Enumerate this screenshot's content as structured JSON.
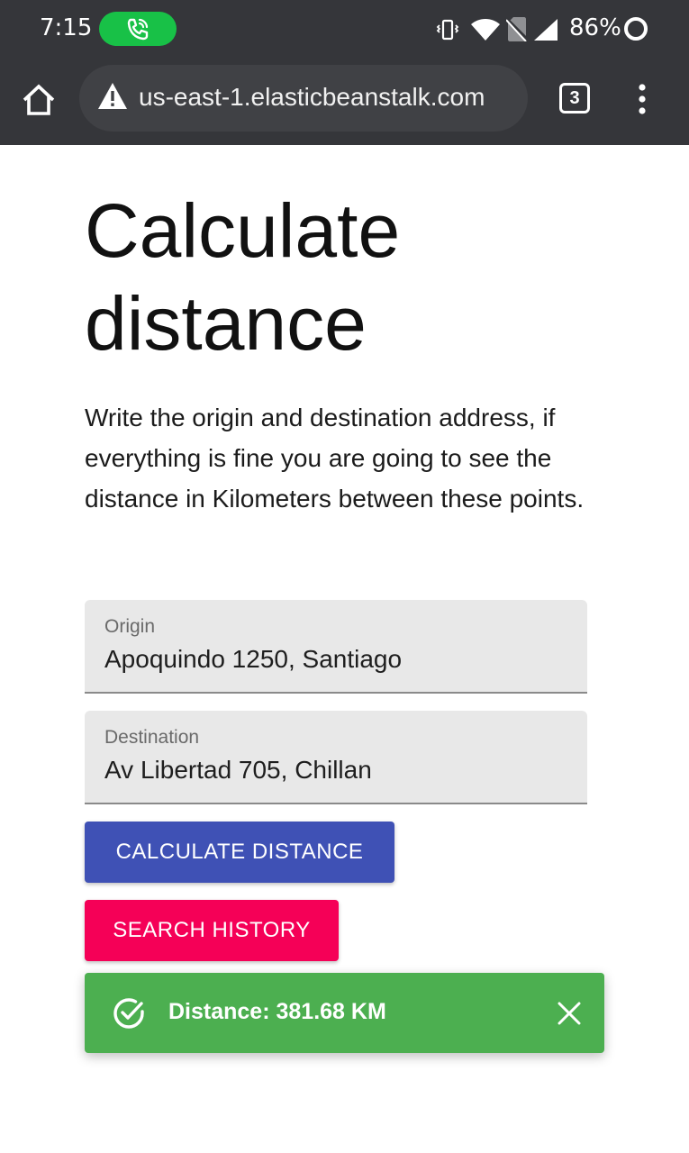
{
  "status_bar": {
    "time": "7:15",
    "battery": "86%",
    "icons": [
      "phone-call-icon",
      "vibrate-icon",
      "wifi-icon",
      "no-sim-icon",
      "signal-icon",
      "battery-ring-icon"
    ]
  },
  "browser": {
    "url": "us-east-1.elasticbeanstalk.com",
    "tab_count": "3",
    "icons": [
      "home-icon",
      "warning-icon",
      "tab-switcher-icon",
      "overflow-menu-icon"
    ]
  },
  "page": {
    "title": "Calculate distance",
    "description": "Write the origin and destination address, if everything is fine you are going to see the distance in Kilometers between these points."
  },
  "form": {
    "origin_label": "Origin",
    "origin_value": "Apoquindo 1250, Santiago",
    "destination_label": "Destination",
    "destination_value": "Av Libertad 705, Chillan",
    "calculate_label": "CALCULATE DISTANCE",
    "history_label": "SEARCH HISTORY"
  },
  "toast": {
    "message": "Distance: 381.68 KM"
  },
  "colors": {
    "chrome_bar": "#35363a",
    "calculate_button": "#3f51b5",
    "history_button": "#f50057",
    "toast_success": "#4caf50",
    "call_pill": "#18c147"
  }
}
